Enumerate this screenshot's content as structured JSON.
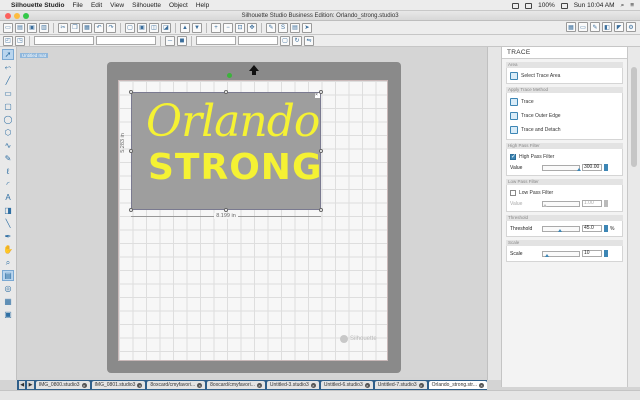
{
  "menubar": {
    "app_name": "Silhouette Studio",
    "items": [
      "File",
      "Edit",
      "View",
      "Silhouette",
      "Object",
      "Help"
    ],
    "battery": "100%",
    "clock": "Sun 10:04 AM"
  },
  "window": {
    "title": "Silhouette Studio Business Edition: Orlando_strong.studio3"
  },
  "toolbar2": {
    "field1": "",
    "field2": ""
  },
  "canvas": {
    "ruler_tag": "Untitled mat",
    "photo_line1": "Orlando",
    "photo_line2": "STRONG",
    "width_dim": "8.199 in",
    "height_dim": "5.283 in",
    "watermark": "Silhouette"
  },
  "panel": {
    "title": "TRACE",
    "sections": {
      "area": "Area",
      "method": "Apply Trace Method",
      "high_pass": "High Pass Filter",
      "low_pass": "Low Pass Filter",
      "threshold": "Threshold",
      "scale": "Scale"
    },
    "select_area": "Select Trace Area",
    "methods": [
      "Trace",
      "Trace Outer Edge",
      "Trace and Detach"
    ],
    "high_pass_label": "High Pass Filter",
    "high_pass_checked": true,
    "high_pass_value_label": "Value",
    "high_pass_value": "300.00",
    "low_pass_label": "Low Pass Filter",
    "low_pass_checked": false,
    "low_pass_value_label": "Value",
    "low_pass_value": "1.00",
    "threshold_label": "Threshold",
    "threshold_value": "45.0",
    "threshold_unit": "%",
    "threshold_fraction": 0.45,
    "scale_label": "Scale",
    "scale_value": "10",
    "scale_fraction": 0.05
  },
  "tabs": [
    {
      "label": "IMG_0800.studio3",
      "active": false
    },
    {
      "label": "IMG_0801.studio3",
      "active": false
    },
    {
      "label": "8oxcard/cmyfavori...",
      "active": false
    },
    {
      "label": "8oxcard/cmyfavori...",
      "active": false
    },
    {
      "label": "Untitled-3.studio3",
      "active": false
    },
    {
      "label": "Untitled-6.studio3",
      "active": false
    },
    {
      "label": "Untitled-7.studio3",
      "active": false
    },
    {
      "label": "Orlando_strong.str...",
      "active": true
    }
  ],
  "colors": {
    "accent": "#3d86b5",
    "lettering": "#f5f233",
    "tab_bar": "#2f5f8a"
  }
}
